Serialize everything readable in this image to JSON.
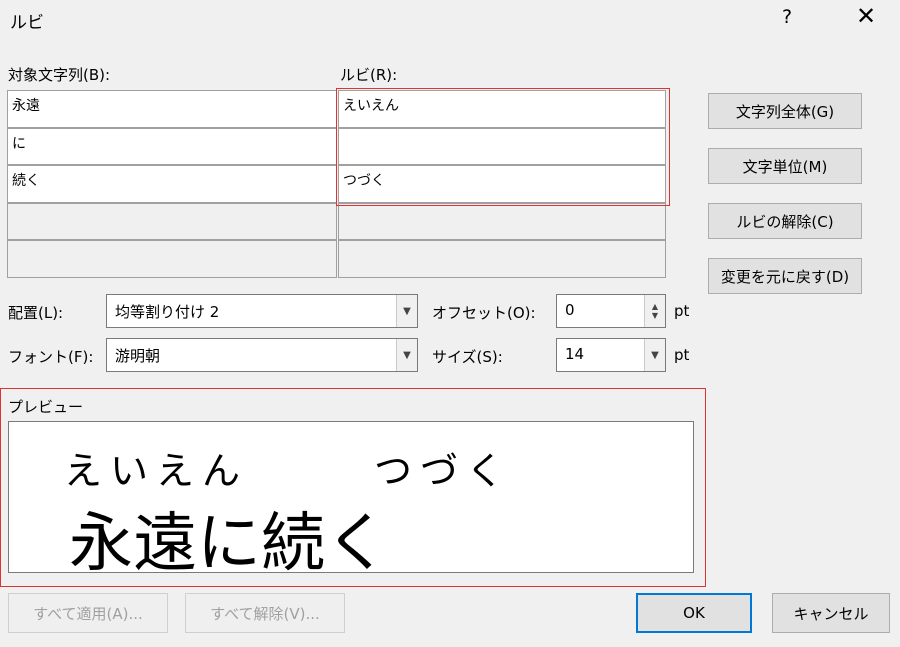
{
  "dialog": {
    "title": "ルビ",
    "help": "?",
    "close": "✕"
  },
  "table": {
    "target_header": "対象文字列(B):",
    "ruby_header": "ルビ(R):",
    "rows": [
      {
        "target": "永遠",
        "ruby": "えいえん"
      },
      {
        "target": "に",
        "ruby": ""
      },
      {
        "target": "続く",
        "ruby": "つづく"
      },
      {
        "target": "",
        "ruby": ""
      },
      {
        "target": "",
        "ruby": ""
      }
    ]
  },
  "side_buttons": {
    "whole": "文字列全体(G)",
    "char": "文字単位(M)",
    "remove": "ルビの解除(C)",
    "reset": "変更を元に戻す(D)"
  },
  "options": {
    "alignment_label": "配置(L):",
    "alignment_value": "均等割り付け 2",
    "offset_label": "オフセット(O):",
    "offset_value": "0",
    "offset_unit": "pt",
    "font_label": "フォント(F):",
    "font_value": "游明朝",
    "size_label": "サイズ(S):",
    "size_value": "14",
    "size_unit": "pt"
  },
  "preview": {
    "label": "プレビュー",
    "ruby1": "えいえん",
    "ruby2": "つづく",
    "text": "永遠に続く"
  },
  "bottom_buttons": {
    "apply_all": "すべて適用(A)...",
    "remove_all": "すべて解除(V)...",
    "ok": "OK",
    "cancel": "キャンセル"
  },
  "colors": {
    "highlight": "#dd3333",
    "ok_border": "#0078d7"
  }
}
